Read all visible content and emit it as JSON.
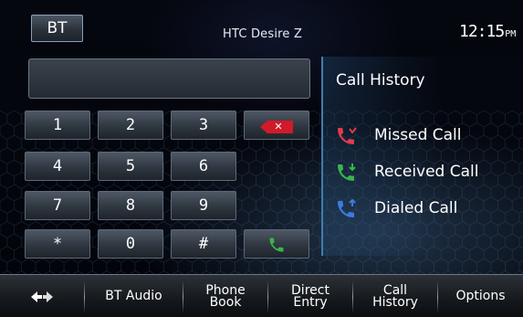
{
  "header": {
    "bt_button_label": "BT",
    "device_name": "HTC Desire Z",
    "clock_time": "12:15",
    "clock_ampm": "PM"
  },
  "dialer": {
    "display_value": "",
    "keys": [
      "1",
      "2",
      "3",
      "4",
      "5",
      "6",
      "7",
      "8",
      "9",
      "*",
      "0",
      "#"
    ],
    "delete_icon": "delete-icon",
    "call_icon": "call-icon"
  },
  "call_history": {
    "title": "Call History",
    "items": [
      {
        "label": "Missed Call",
        "icon": "missed-call-icon",
        "color": "#e23a4e"
      },
      {
        "label": "Received Call",
        "icon": "received-call-icon",
        "color": "#39b54a"
      },
      {
        "label": "Dialed Call",
        "icon": "dialed-call-icon",
        "color": "#3d7be0"
      }
    ]
  },
  "bottom_bar": {
    "back_icon": "back-icon",
    "bt_audio": "BT Audio",
    "phone_book_line1": "Phone",
    "phone_book_line2": "Book",
    "direct_entry_line1": "Direct",
    "direct_entry_line2": "Entry",
    "call_history_line1": "Call",
    "call_history_line2": "History",
    "options": "Options"
  },
  "colors": {
    "accent_blue": "#3c7fb0",
    "delete_red": "#d21a2a",
    "call_green": "#39b54a"
  }
}
